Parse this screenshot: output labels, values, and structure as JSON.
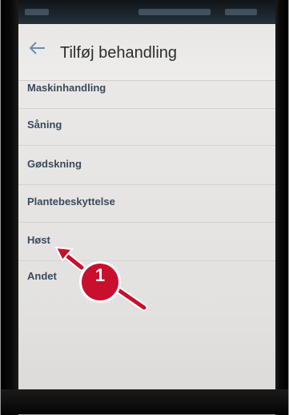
{
  "app_bar": {
    "title": "Tilføj behandling",
    "back_icon": "arrow-left-icon"
  },
  "list": {
    "items": [
      {
        "label": "Maskinhandling"
      },
      {
        "label": "Såning"
      },
      {
        "label": "Gødskning"
      },
      {
        "label": "Plantebeskyttelse"
      },
      {
        "label": "Høst"
      },
      {
        "label": "Andet"
      }
    ]
  },
  "callout": {
    "number": "1",
    "color": "#c8102e"
  },
  "colors": {
    "item_text": "#3a4a5c",
    "title_text": "#2c2d30",
    "screen_bg": "#e8e7e5"
  }
}
